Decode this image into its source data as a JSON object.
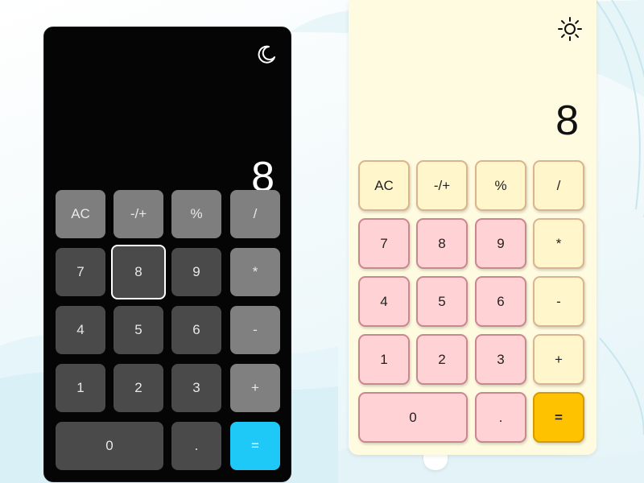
{
  "dark_calculator": {
    "theme_icon": "moon-icon",
    "display": "8",
    "keys": [
      {
        "label": "AC",
        "style": "fn"
      },
      {
        "label": "-/+",
        "style": "fn"
      },
      {
        "label": "%",
        "style": "fn"
      },
      {
        "label": "/",
        "style": "op"
      },
      {
        "label": "7",
        "style": "num"
      },
      {
        "label": "8",
        "style": "num",
        "selected": true
      },
      {
        "label": "9",
        "style": "num"
      },
      {
        "label": "*",
        "style": "op"
      },
      {
        "label": "4",
        "style": "num"
      },
      {
        "label": "5",
        "style": "num"
      },
      {
        "label": "6",
        "style": "num"
      },
      {
        "label": "-",
        "style": "op"
      },
      {
        "label": "1",
        "style": "num"
      },
      {
        "label": "2",
        "style": "num"
      },
      {
        "label": "3",
        "style": "num"
      },
      {
        "label": "+",
        "style": "op"
      },
      {
        "label": "0",
        "style": "num"
      },
      {
        "label": ".",
        "style": "num"
      },
      {
        "label": "=",
        "style": "eq"
      }
    ]
  },
  "light_calculator": {
    "theme_icon": "sun-icon",
    "display": "8",
    "keys": [
      {
        "label": "AC",
        "style": "cream"
      },
      {
        "label": "-/+",
        "style": "cream"
      },
      {
        "label": "%",
        "style": "cream"
      },
      {
        "label": "/",
        "style": "cream"
      },
      {
        "label": "7",
        "style": "pink"
      },
      {
        "label": "8",
        "style": "pink"
      },
      {
        "label": "9",
        "style": "pink"
      },
      {
        "label": "*",
        "style": "cream"
      },
      {
        "label": "4",
        "style": "pink"
      },
      {
        "label": "5",
        "style": "pink"
      },
      {
        "label": "6",
        "style": "pink"
      },
      {
        "label": "-",
        "style": "cream"
      },
      {
        "label": "1",
        "style": "pink"
      },
      {
        "label": "2",
        "style": "pink"
      },
      {
        "label": "3",
        "style": "pink"
      },
      {
        "label": "+",
        "style": "cream"
      },
      {
        "label": "0",
        "style": "pink"
      },
      {
        "label": ".",
        "style": "pink"
      },
      {
        "label": "=",
        "style": "eq"
      }
    ]
  },
  "colors": {
    "dark_body": "#050505",
    "dark_fn_key": "#7e7e7e",
    "dark_num_key": "#4a4a4a",
    "dark_equals": "#1ec8f7",
    "light_body": "#fffbe0",
    "light_cream_key": "#fff6cc",
    "light_pink_key": "#ffd2d6",
    "light_equals": "#ffc200"
  }
}
